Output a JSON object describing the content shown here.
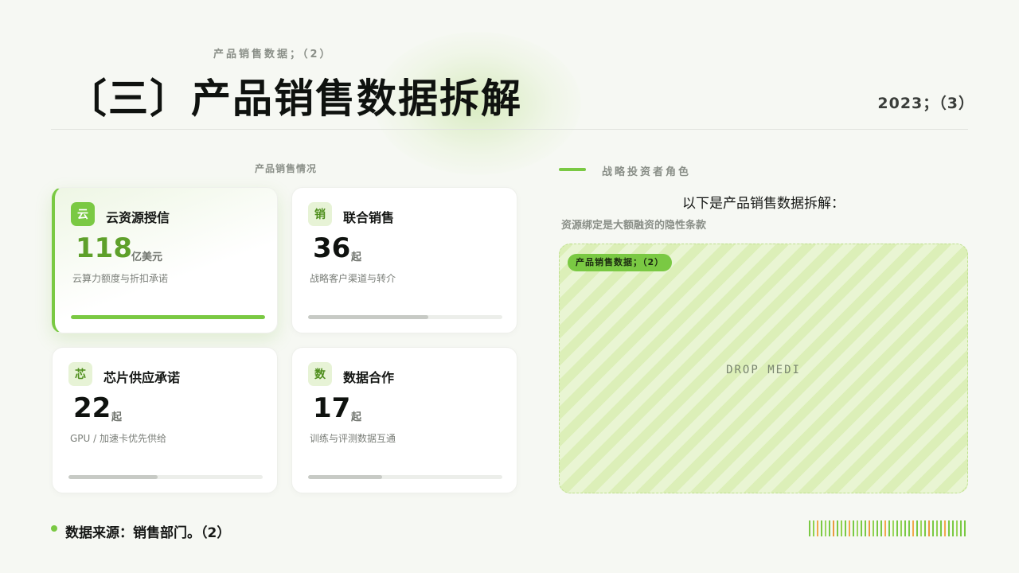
{
  "header": {
    "eyebrow": "产品销售数据；（2）",
    "title": "〔三〕产品销售数据拆解",
    "year": "2023；（3）"
  },
  "left": {
    "heading": "产品销售情况",
    "cards": [
      {
        "icon_char": "云",
        "icon": "cloud-icon",
        "title": "云资源授信",
        "value": "118",
        "unit": "亿美元",
        "desc": "云算力额度与折扣承诺",
        "progress": 1.0,
        "active": true
      },
      {
        "icon_char": "销",
        "icon": "sales-icon",
        "title": "联合销售",
        "value": "36",
        "unit": "起",
        "desc": "战略客户渠道与转介",
        "progress": 0.62,
        "active": false
      },
      {
        "icon_char": "芯",
        "icon": "chip-icon",
        "title": "芯片供应承诺",
        "value": "22",
        "unit": "起",
        "desc": "GPU / 加速卡优先供给",
        "progress": 0.46,
        "active": false
      },
      {
        "icon_char": "数",
        "icon": "data-icon",
        "title": "数据合作",
        "value": "17",
        "unit": "起",
        "desc": "训练与评测数据互通",
        "progress": 0.38,
        "active": false
      }
    ]
  },
  "right": {
    "heading": "战略投资者角色",
    "title": "以下是产品销售数据拆解：",
    "subtitle": "资源绑定是大额融资的隐性条款",
    "media_tag": "产品销售数据；（2）",
    "media_placeholder": "DROP MEDI"
  },
  "footer": {
    "source": "数据来源：销售部门。（2）"
  },
  "colors": {
    "accent": "#7ac943",
    "barcode": [
      "#7ac943",
      "#8fd14f",
      "#f0a94a",
      "#7ac943",
      "#9ad65c",
      "#7ac943",
      "#e79b3e",
      "#7ac943",
      "#8fd14f",
      "#7ac943",
      "#f0a94a",
      "#7ac943",
      "#9ad65c",
      "#7ac943",
      "#7ac943",
      "#e79b3e",
      "#8fd14f",
      "#7ac943",
      "#7ac943",
      "#f0a94a",
      "#7ac943",
      "#9ad65c",
      "#7ac943",
      "#8fd14f",
      "#7ac943",
      "#7ac943",
      "#f0a94a",
      "#7ac943",
      "#9ad65c",
      "#7ac943",
      "#e79b3e",
      "#7ac943",
      "#8fd14f",
      "#7ac943",
      "#f0a94a",
      "#7ac943",
      "#7ac943",
      "#9ad65c",
      "#7ac943",
      "#7ac943"
    ]
  }
}
